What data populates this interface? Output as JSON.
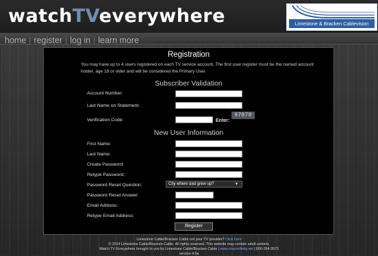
{
  "header": {
    "logo_watch": "watch",
    "logo_tv": "TV",
    "logo_everywhere": "everywhere",
    "brand_label": "Limestone & Bracken Cablevision",
    "brand_color": "#2d5fa2"
  },
  "nav": {
    "items": [
      "home",
      "register",
      "log in",
      "learn more"
    ],
    "separator": "|"
  },
  "registration": {
    "title": "Registration",
    "intro": "You may have up to 4 users registered on each TV service account. The first user register must be the named account holder, age 18 or older and will be considered the Primary User.",
    "subscriber_section": "Subscriber Validation",
    "account_number_label": "Account Number:",
    "last_name_label": "Last Name on Statement:",
    "verification_label": "Verification Code:",
    "enter_label": "Enter:",
    "captcha_code": "97878",
    "user_section": "New User Information",
    "first_name_label": "First Name:",
    "user_last_name_label": "Last Name:",
    "create_password_label": "Create Password:",
    "retype_password_label": "Retype Password:",
    "reset_question_label": "Password Reset Question:",
    "reset_question_value": "City where dad grew up?",
    "reset_answer_label": "Password Reset Answer:",
    "email_label": "Email Address:",
    "retype_email_label": "Retype Email Address:",
    "register_button": "Register"
  },
  "footer": {
    "line1_text": "Limestone Cable/Bracken Cable not your TV provider?",
    "line1_link": "Click here",
    "line2": "© 2014 Limestone Cable/Bracken Cable. All rights reserved. This website may contain adult content.",
    "line3_text": "Watch TV Everywhere brought to you by Limestone Cable/Bracken Cable |",
    "line3_link": "www.maysvilleky.net",
    "line3_phone": "| 800-264-3572",
    "line4": "version 4.0a"
  }
}
